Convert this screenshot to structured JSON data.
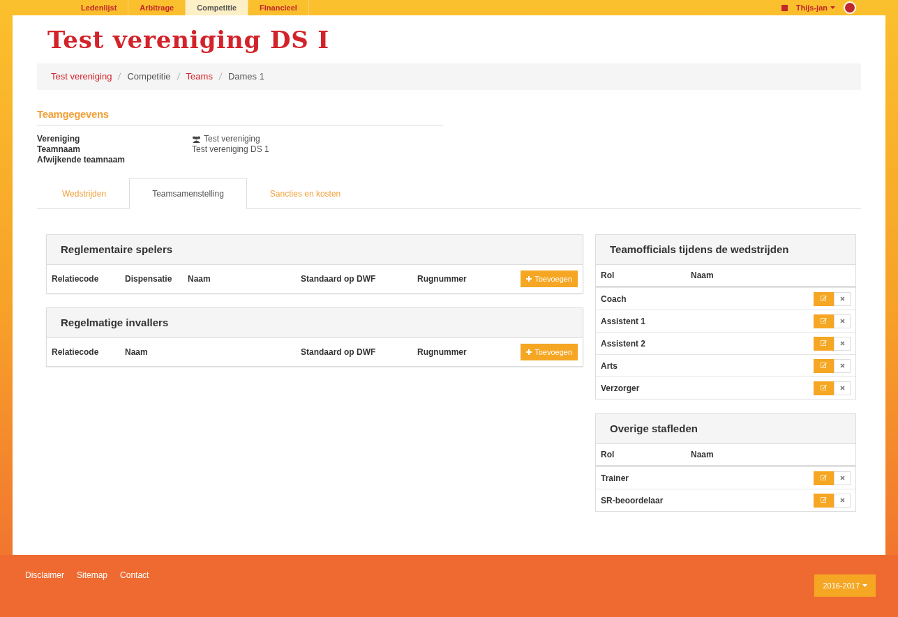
{
  "top_nav": {
    "items": [
      {
        "label": "Ledenlijst",
        "selected": false
      },
      {
        "label": "Arbitrage",
        "selected": false
      },
      {
        "label": "Competitie",
        "selected": true
      },
      {
        "label": "Financieel",
        "selected": false
      }
    ],
    "user": "Thijs-jan"
  },
  "title": "Test vereniging DS I",
  "breadcrumb": [
    {
      "label": "Test vereniging",
      "link": true
    },
    {
      "label": "Competitie",
      "link": false
    },
    {
      "label": "Teams",
      "link": true
    },
    {
      "label": "Dames 1",
      "link": false
    }
  ],
  "team_details": {
    "heading": "Teamgegevens",
    "fields": [
      {
        "label": "Vereniging",
        "value": "Test vereniging",
        "kind": "club"
      },
      {
        "label": "Teamnaam",
        "value": "Test vereniging DS 1",
        "kind": "plain"
      },
      {
        "label": "Afwijkende teamnaam"
      }
    ]
  },
  "tabs": [
    {
      "label": "Wedstrijden",
      "selected": false
    },
    {
      "label": "Teamsamenstelling",
      "selected": true
    },
    {
      "label": "Sancties en kosten",
      "selected": false
    }
  ],
  "player_panels": [
    {
      "title": "Reglementaire spelers",
      "columns": [
        "Relatiecode",
        "Dispensatie",
        "Naam",
        "Standaard op DWF",
        "Rugnummer"
      ],
      "button": "Toevoegen"
    },
    {
      "title": "Regelmatige invallers",
      "columns": [
        "Relatiecode",
        "Naam",
        "Standaard op DWF",
        "Rugnummer"
      ],
      "button": "Toevoegen"
    }
  ],
  "staff_panels": [
    {
      "title": "Teamofficials tijdens de wedstrijden",
      "columns": [
        "Rol",
        "Naam"
      ],
      "rows": [
        "Coach",
        "Assistent 1",
        "Assistent 2",
        "Arts",
        "Verzorger"
      ]
    },
    {
      "title": "Overige stafleden",
      "columns": [
        "Rol",
        "Naam"
      ],
      "rows": [
        "Trainer",
        "SR-beoordelaar"
      ]
    }
  ],
  "footer": {
    "links": [
      "Disclaimer",
      "Sitemap",
      "Contact"
    ],
    "season": "2016-2017"
  }
}
